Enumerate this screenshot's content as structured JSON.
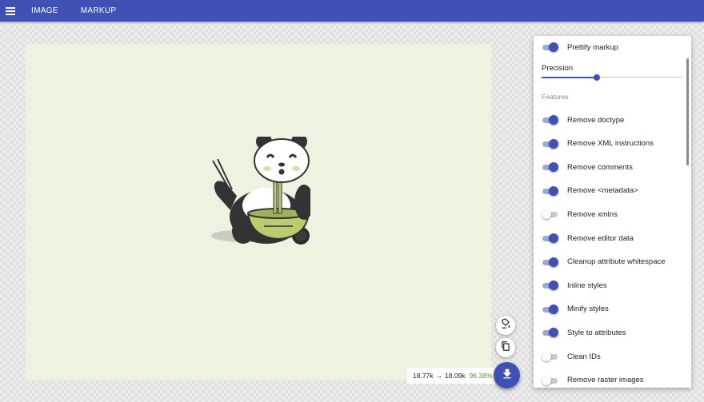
{
  "nav": {
    "tabs": [
      {
        "label": "IMAGE"
      },
      {
        "label": "MARKUP"
      }
    ]
  },
  "settings": {
    "prettify": {
      "label": "Prettify markup",
      "on": true
    },
    "precision": {
      "label": "Precision",
      "value_fraction": 0.39
    },
    "features_title": "Features",
    "features": [
      {
        "label": "Remove doctype",
        "on": true
      },
      {
        "label": "Remove XML instructions",
        "on": true
      },
      {
        "label": "Remove comments",
        "on": true
      },
      {
        "label": "Remove <metadata>",
        "on": true
      },
      {
        "label": "Remove xmlns",
        "on": false
      },
      {
        "label": "Remove editor data",
        "on": true
      },
      {
        "label": "Cleanup attribute whitespace",
        "on": true
      },
      {
        "label": "Inline styles",
        "on": true
      },
      {
        "label": "Minify styles",
        "on": true
      },
      {
        "label": "Style to attributes",
        "on": true
      },
      {
        "label": "Clean IDs",
        "on": false
      },
      {
        "label": "Remove raster images",
        "on": false
      }
    ]
  },
  "status": {
    "original_size": "18.77k",
    "arrow": "→",
    "optimized_size": "18.09k",
    "percent": "96.38%"
  },
  "colors": {
    "primary": "#3f51b5",
    "canvas_bg": "#edf3e1",
    "percent_green": "#5a9a3a"
  },
  "icons": {
    "menu": "menu-icon",
    "background": "format-paint-icon",
    "copy": "copy-icon",
    "download": "download-icon"
  }
}
